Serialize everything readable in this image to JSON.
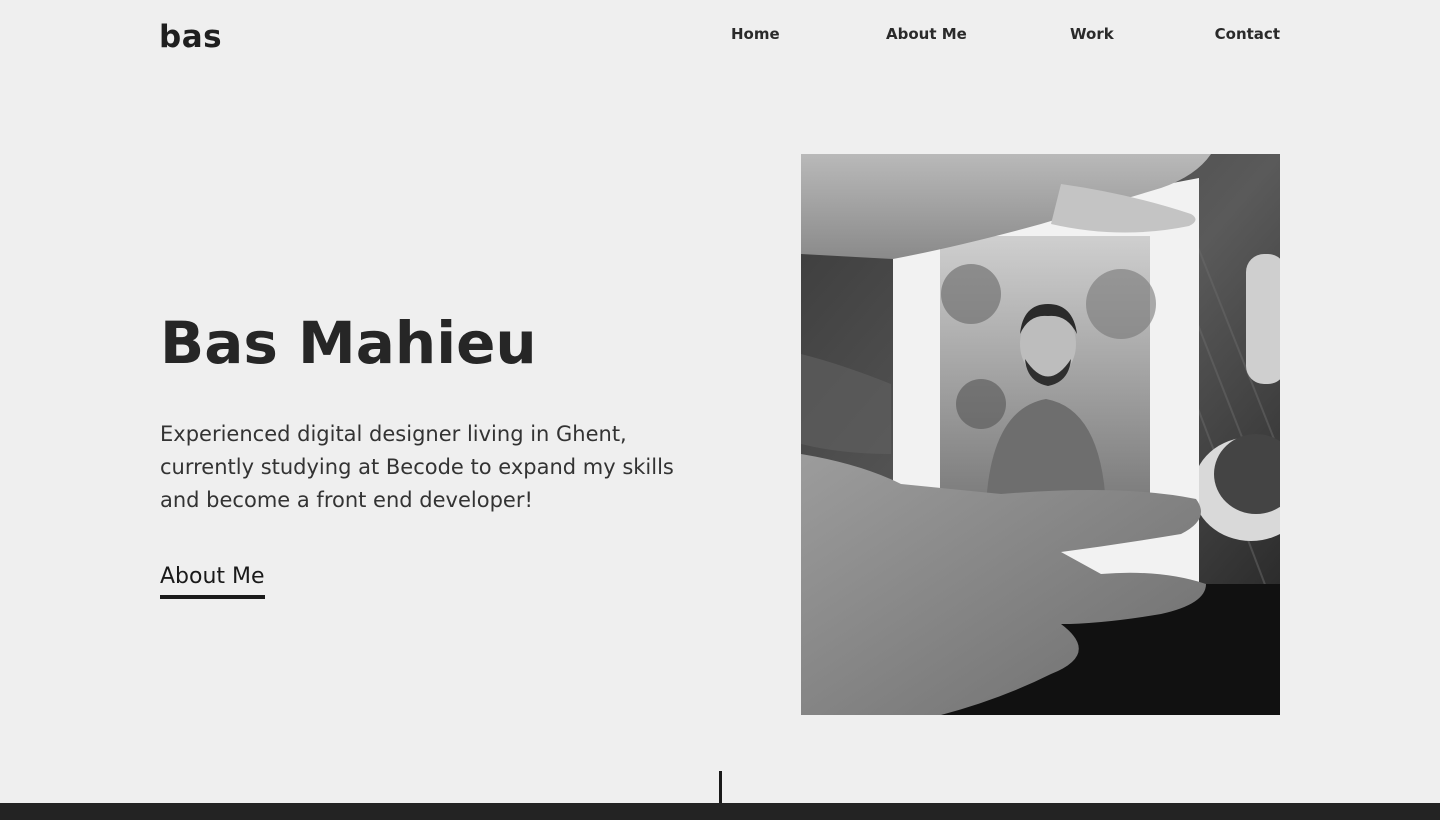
{
  "header": {
    "logo": "bas",
    "nav": [
      {
        "label": "Home"
      },
      {
        "label": "About Me"
      },
      {
        "label": "Work"
      },
      {
        "label": "Contact"
      }
    ]
  },
  "hero": {
    "title": "Bas Mahieu",
    "description": "Experienced digital designer living in Ghent, currently studying at Becode to expand my skills and become a front end developer!",
    "cta_label": "About Me",
    "image": "hands-holding-polaroid-portrait-photo"
  },
  "colors": {
    "background": "#efefef",
    "text": "#262626",
    "footer": "#232323"
  }
}
